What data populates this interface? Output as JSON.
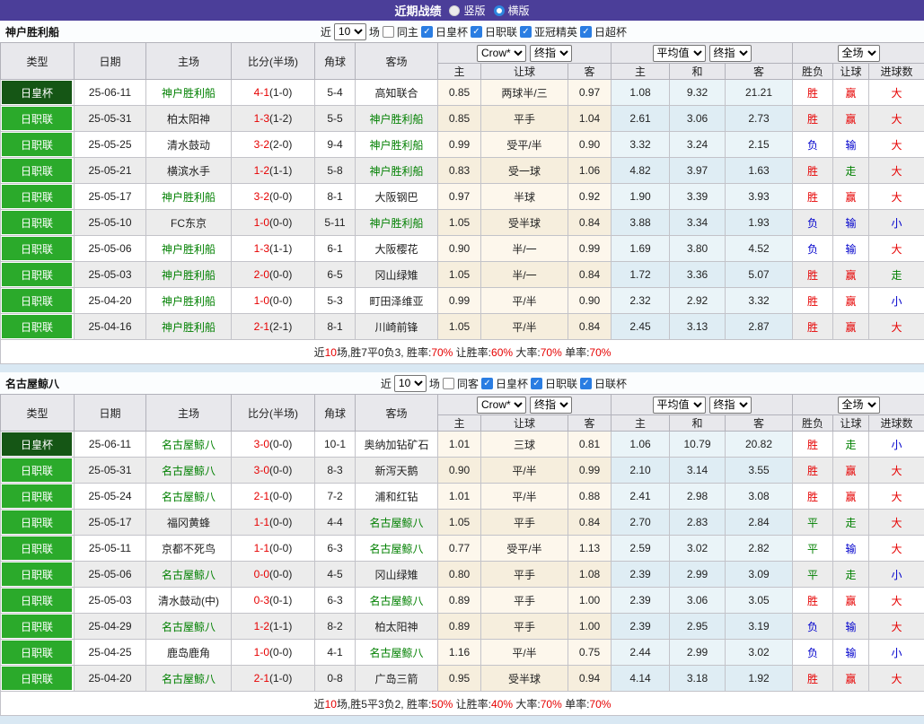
{
  "topbar": {
    "title": "近期战绩",
    "radios": [
      {
        "label": "竖版",
        "selected": true
      },
      {
        "label": "横版",
        "selected": false
      }
    ]
  },
  "colors": {
    "topbar_bg": "#4b3e99",
    "cup_badge": "#155615",
    "league_badge": "#2baa2b",
    "team_green": "#008000",
    "result_red": "#e60000",
    "result_blue": "#0000cc",
    "result_green": "#008000"
  },
  "sections": [
    {
      "team": "神户胜利船",
      "filter": {
        "near_label": "近",
        "count_value": "10",
        "games_label": "场",
        "same_checkbox": {
          "label": "同主",
          "checked": false
        },
        "leagues": [
          {
            "label": "日皇杯",
            "checked": true
          },
          {
            "label": "日职联",
            "checked": true
          },
          {
            "label": "亚冠精英",
            "checked": true
          },
          {
            "label": "日超杯",
            "checked": true
          }
        ]
      },
      "header": {
        "base_cols": [
          "类型",
          "日期",
          "主场",
          "比分(半场)",
          "角球",
          "客场"
        ],
        "group1": {
          "select1": "Crow*",
          "select2": "终指",
          "cols": [
            "主",
            "让球",
            "客"
          ]
        },
        "group2": {
          "select1": "平均值",
          "select2": "终指",
          "cols": [
            "主",
            "和",
            "客"
          ]
        },
        "group3": {
          "select": "全场",
          "cols": [
            "胜负",
            "让球",
            "进球数"
          ]
        }
      },
      "rows": [
        {
          "type": "日皇杯",
          "type_style": "cup",
          "date": "25-06-11",
          "home": "神户胜利船",
          "home_green": true,
          "score": "4-1",
          "half": "(1-0)",
          "corner": "5-4",
          "away": "高知联合",
          "away_green": false,
          "odds1": [
            "0.85",
            "两球半/三",
            "0.97"
          ],
          "odds2": [
            "1.08",
            "9.32",
            "21.21"
          ],
          "results": [
            {
              "t": "胜",
              "c": "red"
            },
            {
              "t": "赢",
              "c": "red"
            },
            {
              "t": "大",
              "c": "red"
            }
          ]
        },
        {
          "type": "日职联",
          "type_style": "league",
          "date": "25-05-31",
          "home": "柏太阳神",
          "home_green": false,
          "score": "1-3",
          "half": "(1-2)",
          "corner": "5-5",
          "away": "神户胜利船",
          "away_green": true,
          "odds1": [
            "0.85",
            "平手",
            "1.04"
          ],
          "odds2": [
            "2.61",
            "3.06",
            "2.73"
          ],
          "results": [
            {
              "t": "胜",
              "c": "red"
            },
            {
              "t": "赢",
              "c": "red"
            },
            {
              "t": "大",
              "c": "red"
            }
          ]
        },
        {
          "type": "日职联",
          "type_style": "league",
          "date": "25-05-25",
          "home": "清水鼓动",
          "home_green": false,
          "score": "3-2",
          "half": "(2-0)",
          "corner": "9-4",
          "away": "神户胜利船",
          "away_green": true,
          "odds1": [
            "0.99",
            "受平/半",
            "0.90"
          ],
          "odds2": [
            "3.32",
            "3.24",
            "2.15"
          ],
          "results": [
            {
              "t": "负",
              "c": "blue"
            },
            {
              "t": "输",
              "c": "blue"
            },
            {
              "t": "大",
              "c": "red"
            }
          ]
        },
        {
          "type": "日职联",
          "type_style": "league",
          "date": "25-05-21",
          "home": "横滨水手",
          "home_green": false,
          "score": "1-2",
          "half": "(1-1)",
          "corner": "5-8",
          "away": "神户胜利船",
          "away_green": true,
          "odds1": [
            "0.83",
            "受一球",
            "1.06"
          ],
          "odds2": [
            "4.82",
            "3.97",
            "1.63"
          ],
          "results": [
            {
              "t": "胜",
              "c": "red"
            },
            {
              "t": "走",
              "c": "green"
            },
            {
              "t": "大",
              "c": "red"
            }
          ]
        },
        {
          "type": "日职联",
          "type_style": "league",
          "date": "25-05-17",
          "home": "神户胜利船",
          "home_green": true,
          "score": "3-2",
          "half": "(0-0)",
          "corner": "8-1",
          "away": "大阪钢巴",
          "away_green": false,
          "odds1": [
            "0.97",
            "半球",
            "0.92"
          ],
          "odds2": [
            "1.90",
            "3.39",
            "3.93"
          ],
          "results": [
            {
              "t": "胜",
              "c": "red"
            },
            {
              "t": "赢",
              "c": "red"
            },
            {
              "t": "大",
              "c": "red"
            }
          ]
        },
        {
          "type": "日职联",
          "type_style": "league",
          "date": "25-05-10",
          "home": "FC东京",
          "home_green": false,
          "score": "1-0",
          "half": "(0-0)",
          "corner": "5-11",
          "away": "神户胜利船",
          "away_green": true,
          "odds1": [
            "1.05",
            "受半球",
            "0.84"
          ],
          "odds2": [
            "3.88",
            "3.34",
            "1.93"
          ],
          "results": [
            {
              "t": "负",
              "c": "blue"
            },
            {
              "t": "输",
              "c": "blue"
            },
            {
              "t": "小",
              "c": "blue"
            }
          ]
        },
        {
          "type": "日职联",
          "type_style": "league",
          "date": "25-05-06",
          "home": "神户胜利船",
          "home_green": true,
          "score": "1-3",
          "half": "(1-1)",
          "corner": "6-1",
          "away": "大阪樱花",
          "away_green": false,
          "odds1": [
            "0.90",
            "半/一",
            "0.99"
          ],
          "odds2": [
            "1.69",
            "3.80",
            "4.52"
          ],
          "results": [
            {
              "t": "负",
              "c": "blue"
            },
            {
              "t": "输",
              "c": "blue"
            },
            {
              "t": "大",
              "c": "red"
            }
          ]
        },
        {
          "type": "日职联",
          "type_style": "league",
          "date": "25-05-03",
          "home": "神户胜利船",
          "home_green": true,
          "score": "2-0",
          "half": "(0-0)",
          "corner": "6-5",
          "away": "冈山绿雉",
          "away_green": false,
          "odds1": [
            "1.05",
            "半/一",
            "0.84"
          ],
          "odds2": [
            "1.72",
            "3.36",
            "5.07"
          ],
          "results": [
            {
              "t": "胜",
              "c": "red"
            },
            {
              "t": "赢",
              "c": "red"
            },
            {
              "t": "走",
              "c": "green"
            }
          ]
        },
        {
          "type": "日职联",
          "type_style": "league",
          "date": "25-04-20",
          "home": "神户胜利船",
          "home_green": true,
          "score": "1-0",
          "half": "(0-0)",
          "corner": "5-3",
          "away": "町田泽维亚",
          "away_green": false,
          "odds1": [
            "0.99",
            "平/半",
            "0.90"
          ],
          "odds2": [
            "2.32",
            "2.92",
            "3.32"
          ],
          "results": [
            {
              "t": "胜",
              "c": "red"
            },
            {
              "t": "赢",
              "c": "red"
            },
            {
              "t": "小",
              "c": "blue"
            }
          ]
        },
        {
          "type": "日职联",
          "type_style": "league",
          "date": "25-04-16",
          "home": "神户胜利船",
          "home_green": true,
          "score": "2-1",
          "half": "(2-1)",
          "corner": "8-1",
          "away": "川崎前锋",
          "away_green": false,
          "odds1": [
            "1.05",
            "平/半",
            "0.84"
          ],
          "odds2": [
            "2.45",
            "3.13",
            "2.87"
          ],
          "results": [
            {
              "t": "胜",
              "c": "red"
            },
            {
              "t": "赢",
              "c": "red"
            },
            {
              "t": "大",
              "c": "red"
            }
          ]
        }
      ],
      "summary": [
        {
          "text": "近",
          "red": false
        },
        {
          "text": "10",
          "red": true
        },
        {
          "text": "场,胜7平0负3, 胜率:",
          "red": false
        },
        {
          "text": "70%",
          "red": true
        },
        {
          "text": " 让胜率:",
          "red": false
        },
        {
          "text": "60%",
          "red": true
        },
        {
          "text": " 大率:",
          "red": false
        },
        {
          "text": "70%",
          "red": true
        },
        {
          "text": " 单率:",
          "red": false
        },
        {
          "text": "70%",
          "red": true
        }
      ]
    },
    {
      "team": "名古屋鲸八",
      "filter": {
        "near_label": "近",
        "count_value": "10",
        "games_label": "场",
        "same_checkbox": {
          "label": "同客",
          "checked": false
        },
        "leagues": [
          {
            "label": "日皇杯",
            "checked": true
          },
          {
            "label": "日职联",
            "checked": true
          },
          {
            "label": "日联杯",
            "checked": true
          }
        ]
      },
      "header": {
        "base_cols": [
          "类型",
          "日期",
          "主场",
          "比分(半场)",
          "角球",
          "客场"
        ],
        "group1": {
          "select1": "Crow*",
          "select2": "终指",
          "cols": [
            "主",
            "让球",
            "客"
          ]
        },
        "group2": {
          "select1": "平均值",
          "select2": "终指",
          "cols": [
            "主",
            "和",
            "客"
          ]
        },
        "group3": {
          "select": "全场",
          "cols": [
            "胜负",
            "让球",
            "进球数"
          ]
        }
      },
      "rows": [
        {
          "type": "日皇杯",
          "type_style": "cup",
          "date": "25-06-11",
          "home": "名古屋鲸八",
          "home_green": true,
          "score": "3-0",
          "half": "(0-0)",
          "corner": "10-1",
          "away": "奥纳加钻矿石",
          "away_green": false,
          "odds1": [
            "1.01",
            "三球",
            "0.81"
          ],
          "odds2": [
            "1.06",
            "10.79",
            "20.82"
          ],
          "results": [
            {
              "t": "胜",
              "c": "red"
            },
            {
              "t": "走",
              "c": "green"
            },
            {
              "t": "小",
              "c": "blue"
            }
          ]
        },
        {
          "type": "日职联",
          "type_style": "league",
          "date": "25-05-31",
          "home": "名古屋鲸八",
          "home_green": true,
          "score": "3-0",
          "half": "(0-0)",
          "corner": "8-3",
          "away": "新泻天鹅",
          "away_green": false,
          "odds1": [
            "0.90",
            "平/半",
            "0.99"
          ],
          "odds2": [
            "2.10",
            "3.14",
            "3.55"
          ],
          "results": [
            {
              "t": "胜",
              "c": "red"
            },
            {
              "t": "赢",
              "c": "red"
            },
            {
              "t": "大",
              "c": "red"
            }
          ]
        },
        {
          "type": "日职联",
          "type_style": "league",
          "date": "25-05-24",
          "home": "名古屋鲸八",
          "home_green": true,
          "score": "2-1",
          "half": "(0-0)",
          "corner": "7-2",
          "away": "浦和红钻",
          "away_green": false,
          "odds1": [
            "1.01",
            "平/半",
            "0.88"
          ],
          "odds2": [
            "2.41",
            "2.98",
            "3.08"
          ],
          "results": [
            {
              "t": "胜",
              "c": "red"
            },
            {
              "t": "赢",
              "c": "red"
            },
            {
              "t": "大",
              "c": "red"
            }
          ]
        },
        {
          "type": "日职联",
          "type_style": "league",
          "date": "25-05-17",
          "home": "福冈黄蜂",
          "home_green": false,
          "score": "1-1",
          "half": "(0-0)",
          "corner": "4-4",
          "away": "名古屋鲸八",
          "away_green": true,
          "odds1": [
            "1.05",
            "平手",
            "0.84"
          ],
          "odds2": [
            "2.70",
            "2.83",
            "2.84"
          ],
          "results": [
            {
              "t": "平",
              "c": "green"
            },
            {
              "t": "走",
              "c": "green"
            },
            {
              "t": "大",
              "c": "red"
            }
          ]
        },
        {
          "type": "日职联",
          "type_style": "league",
          "date": "25-05-11",
          "home": "京都不死鸟",
          "home_green": false,
          "score": "1-1",
          "half": "(0-0)",
          "corner": "6-3",
          "away": "名古屋鲸八",
          "away_green": true,
          "odds1": [
            "0.77",
            "受平/半",
            "1.13"
          ],
          "odds2": [
            "2.59",
            "3.02",
            "2.82"
          ],
          "results": [
            {
              "t": "平",
              "c": "green"
            },
            {
              "t": "输",
              "c": "blue"
            },
            {
              "t": "大",
              "c": "red"
            }
          ]
        },
        {
          "type": "日职联",
          "type_style": "league",
          "date": "25-05-06",
          "home": "名古屋鲸八",
          "home_green": true,
          "score": "0-0",
          "half": "(0-0)",
          "corner": "4-5",
          "away": "冈山绿雉",
          "away_green": false,
          "odds1": [
            "0.80",
            "平手",
            "1.08"
          ],
          "odds2": [
            "2.39",
            "2.99",
            "3.09"
          ],
          "results": [
            {
              "t": "平",
              "c": "green"
            },
            {
              "t": "走",
              "c": "green"
            },
            {
              "t": "小",
              "c": "blue"
            }
          ]
        },
        {
          "type": "日职联",
          "type_style": "league",
          "date": "25-05-03",
          "home": "清水鼓动(中)",
          "home_green": false,
          "score": "0-3",
          "half": "(0-1)",
          "corner": "6-3",
          "away": "名古屋鲸八",
          "away_green": true,
          "odds1": [
            "0.89",
            "平手",
            "1.00"
          ],
          "odds2": [
            "2.39",
            "3.06",
            "3.05"
          ],
          "results": [
            {
              "t": "胜",
              "c": "red"
            },
            {
              "t": "赢",
              "c": "red"
            },
            {
              "t": "大",
              "c": "red"
            }
          ]
        },
        {
          "type": "日职联",
          "type_style": "league",
          "date": "25-04-29",
          "home": "名古屋鲸八",
          "home_green": true,
          "score": "1-2",
          "half": "(1-1)",
          "corner": "8-2",
          "away": "柏太阳神",
          "away_green": false,
          "odds1": [
            "0.89",
            "平手",
            "1.00"
          ],
          "odds2": [
            "2.39",
            "2.95",
            "3.19"
          ],
          "results": [
            {
              "t": "负",
              "c": "blue"
            },
            {
              "t": "输",
              "c": "blue"
            },
            {
              "t": "大",
              "c": "red"
            }
          ]
        },
        {
          "type": "日职联",
          "type_style": "league",
          "date": "25-04-25",
          "home": "鹿岛鹿角",
          "home_green": false,
          "score": "1-0",
          "half": "(0-0)",
          "corner": "4-1",
          "away": "名古屋鲸八",
          "away_green": true,
          "odds1": [
            "1.16",
            "平/半",
            "0.75"
          ],
          "odds2": [
            "2.44",
            "2.99",
            "3.02"
          ],
          "results": [
            {
              "t": "负",
              "c": "blue"
            },
            {
              "t": "输",
              "c": "blue"
            },
            {
              "t": "小",
              "c": "blue"
            }
          ]
        },
        {
          "type": "日职联",
          "type_style": "league",
          "date": "25-04-20",
          "home": "名古屋鲸八",
          "home_green": true,
          "score": "2-1",
          "half": "(1-0)",
          "corner": "0-8",
          "away": "广岛三箭",
          "away_green": false,
          "odds1": [
            "0.95",
            "受半球",
            "0.94"
          ],
          "odds2": [
            "4.14",
            "3.18",
            "1.92"
          ],
          "results": [
            {
              "t": "胜",
              "c": "red"
            },
            {
              "t": "赢",
              "c": "red"
            },
            {
              "t": "大",
              "c": "red"
            }
          ]
        }
      ],
      "summary": [
        {
          "text": "近",
          "red": false
        },
        {
          "text": "10",
          "red": true
        },
        {
          "text": "场,胜5平3负2, 胜率:",
          "red": false
        },
        {
          "text": "50%",
          "red": true
        },
        {
          "text": " 让胜率:",
          "red": false
        },
        {
          "text": "40%",
          "red": true
        },
        {
          "text": " 大率:",
          "red": false
        },
        {
          "text": "70%",
          "red": true
        },
        {
          "text": " 单率:",
          "red": false
        },
        {
          "text": "70%",
          "red": true
        }
      ]
    }
  ]
}
